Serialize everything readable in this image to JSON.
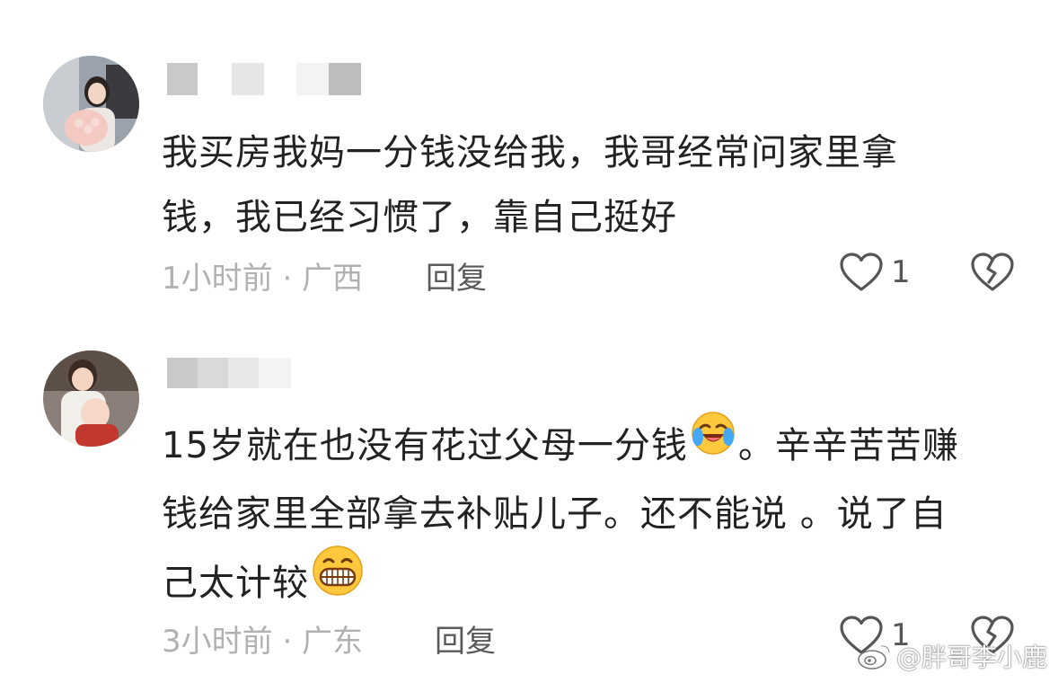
{
  "comments": [
    {
      "text_lines": [
        "我买房我妈一分钱没给我，我哥经常问家里拿",
        "钱，我已经习惯了，靠自己挺好"
      ],
      "time_location": "1小时前 · 广西",
      "reply_label": "回复",
      "like_count": "1"
    },
    {
      "text_line1_a": "15岁就在也没有花过父母一分钱",
      "text_line1_b": "。辛辛苦苦赚",
      "text_line2": "钱给家里全部拿去补贴儿子。还不能说 。说了自",
      "text_line3": "己太计较",
      "emoji1": "laughing-crying-emoji",
      "emoji2": "grinning-emoji",
      "time_location": "3小时前 · 广东",
      "reply_label": "回复",
      "like_count": "1"
    }
  ],
  "watermark": {
    "text": "@胖哥李小鹿",
    "icon": "weibo-logo-icon"
  },
  "colors": {
    "text": "#222222",
    "meta": "#b1b1b1",
    "reply": "#5a5a5a",
    "icon": "#555555",
    "username_blur": [
      "#c8c8c8",
      "#e6e6e6",
      "#f2f2f2",
      "#bdbdbd"
    ]
  }
}
